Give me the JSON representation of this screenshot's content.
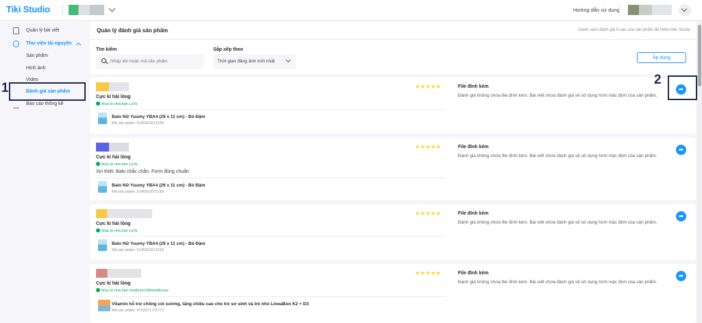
{
  "header": {
    "logo": "Tiki Studio",
    "guide_label": "Hướng dẫn sử dụng"
  },
  "sidebar": {
    "items": [
      {
        "label": "Quản lý bài viết",
        "icon": "document-icon"
      },
      {
        "label": "Thư viện tài nguyên",
        "icon": "library-icon"
      },
      {
        "label": "Sản phẩm"
      },
      {
        "label": "Hình ảnh"
      },
      {
        "label": "Video"
      },
      {
        "label": "Đánh giá sản phẩm"
      },
      {
        "label": "Báo cáo thống kê",
        "icon": "chart-icon"
      }
    ]
  },
  "annotations": {
    "step1": "1",
    "step2": "2"
  },
  "main": {
    "title": "Quản lý đánh giá sản phẩm",
    "subtitle": "Danh sách đánh giá 5 sao của sản phẩm đã thêm trên Studio",
    "search_label": "Tìm kiếm",
    "search_placeholder": "Nhập tên hoặc mã sản phẩm",
    "sort_label": "Sắp xếp theo",
    "sort_value": "Thời gian đăng ảnh mới nhất",
    "apply_label": "Áp dụng"
  },
  "reviews": [
    {
      "rating_text": "Cực kì hài lòng",
      "verified": "Mua từ nhà bán LaTa",
      "comment": "",
      "stars": "★★★★★",
      "product_name": "Balo Nữ Yuumy YBA4 (29 x 11 cm) - Bò Đậm",
      "sku": "Mã sản phẩm: 5145923071159",
      "attach_title": "File đính kèm",
      "attach_text": "Đánh giá không chứa file đính kèm. Bài viết chứa đánh giá sẽ sử dụng hình mặc định của sản phẩm."
    },
    {
      "rating_text": "Cực kì hài lòng",
      "verified": "Mua từ nhà bán LaTa",
      "comment": "Xịn thiệt. Balo chắc chắn. Form đúng chuẩn",
      "stars": "★★★★★",
      "product_name": "Balo Nữ Yuumy YBA4 (29 x 11 cm) - Bò Đậm",
      "sku": "Mã sản phẩm: 5145923071159",
      "attach_title": "File đính kèm",
      "attach_text": "Đánh giá không chứa file đính kèm. Bài viết chứa đánh giá sẽ sử dụng hình mặc định của sản phẩm."
    },
    {
      "rating_text": "Cực kì hài lòng",
      "verified": "Mua từ nhà bán LaTa",
      "comment": "",
      "stars": "★★★★★",
      "product_name": "Balo Nữ Yuumy YBA4 (29 x 11 cm) - Bò Đậm",
      "sku": "Mã sản phẩm: 5145923071159",
      "attach_title": "File đính kèm",
      "attach_text": "Đánh giá không chứa file đính kèm. Bài viết chứa đánh giá sẽ sử dụng hình mặc định của sản phẩm."
    },
    {
      "rating_text": "Cực kì hài lòng",
      "verified": "Mua từ nhà bán nhathuoc24hhealthcare",
      "comment": "",
      "stars": "★★★★★",
      "product_name": "Vitamin hỗ trợ chống còi xương, tăng chiều cao cho trẻ sơ sinh và trẻ nhỏ LineaBon K2 + D3",
      "sku": "Mã sản phẩm: 5722671775777",
      "attach_title": "File đính kèm",
      "attach_text": "Đánh giá không chứa file đính kèm. Bài viết chứa đánh giá sẽ sử dụng hình mặc định của sản phẩm."
    }
  ],
  "colors": {
    "brand": "#1a94ff",
    "verified": "#00ab56",
    "star": "#fdd836",
    "annotation": "#1e2a4a"
  }
}
